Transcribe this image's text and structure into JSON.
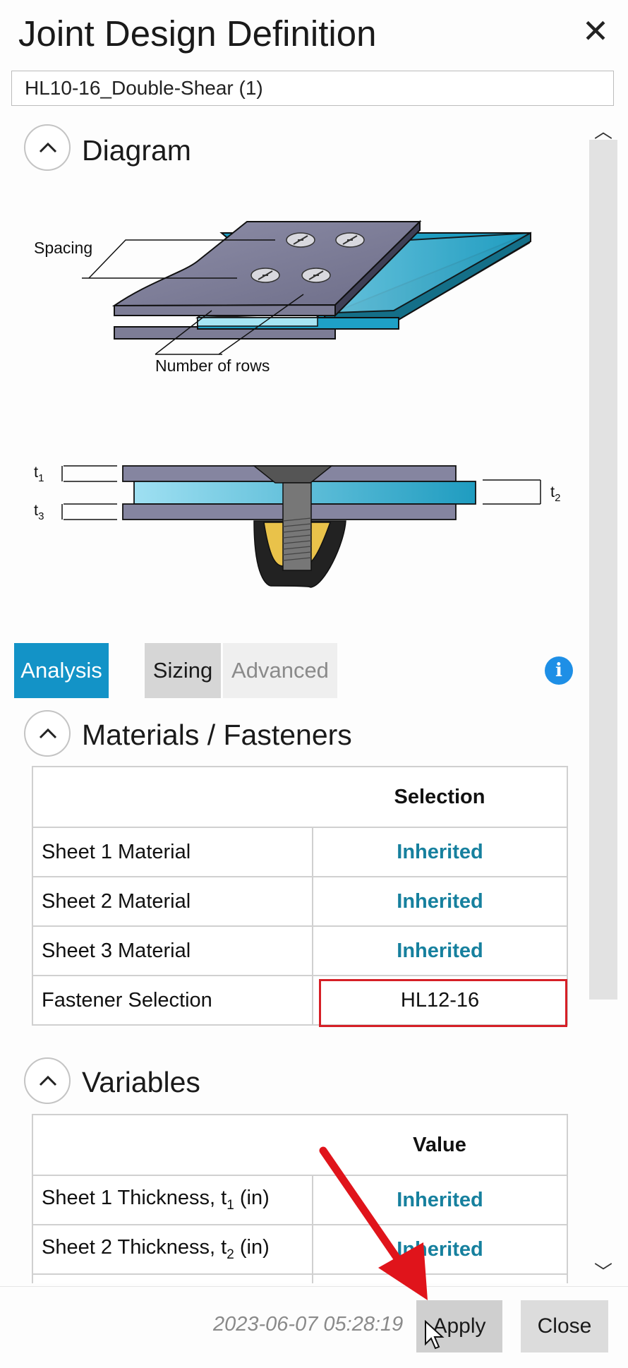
{
  "window": {
    "title": "Joint Design Definition",
    "close_icon": "close-icon"
  },
  "design_name": "HL10-16_Double-Shear (1)",
  "diagram": {
    "title": "Diagram",
    "labels": {
      "spacing": "Spacing",
      "rows": "Number of rows",
      "t1": "t",
      "t1_sub": "1",
      "t2": "t",
      "t2_sub": "2",
      "t3": "t",
      "t3_sub": "3"
    }
  },
  "tabs": [
    {
      "label": "Analysis",
      "active": true
    },
    {
      "label": "Sizing"
    },
    {
      "label": "Advanced"
    }
  ],
  "info_icon": "i",
  "materials": {
    "title": "Materials / Fasteners",
    "header": "Selection",
    "rows": [
      {
        "label": "Sheet 1 Material",
        "value": "Inherited"
      },
      {
        "label": "Sheet 2 Material",
        "value": "Inherited"
      },
      {
        "label": "Sheet 3 Material",
        "value": "Inherited"
      },
      {
        "label": "Fastener Selection",
        "value": "HL12-16"
      }
    ]
  },
  "variables": {
    "title": "Variables",
    "header": "Value",
    "rows": [
      {
        "label": "Sheet 1 Thickness, t",
        "sub": "1",
        "unit": " (in)",
        "value": "Inherited"
      },
      {
        "label": "Sheet 2 Thickness, t",
        "sub": "2",
        "unit": " (in)",
        "value": "Inherited"
      }
    ]
  },
  "footer": {
    "timestamp": "2023-06-07 05:28:19",
    "apply_label": "Apply",
    "close_label": "Close"
  },
  "colors": {
    "accent": "#1393c7",
    "value_text": "#16809e",
    "highlight": "#d61f26",
    "arrow": "#e0141b"
  }
}
